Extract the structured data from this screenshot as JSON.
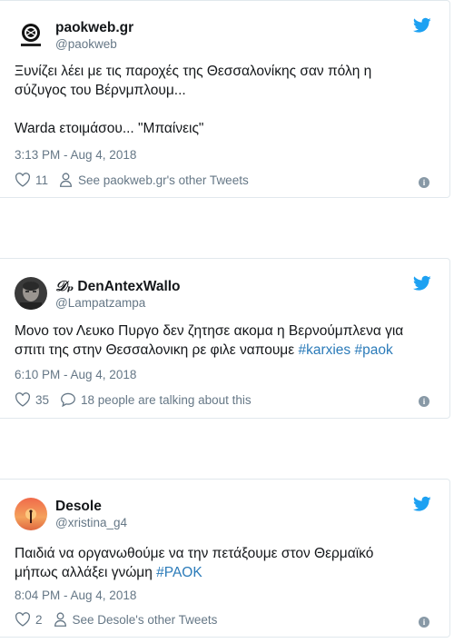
{
  "tweets": [
    {
      "name": "paokweb.gr",
      "handle": "@paokweb",
      "text_line1": "Ξυνίζει λέει με τις παροχές της Θεσσαλονίκης σαν πόλη η",
      "text_line2": "σύζυγος του Βέρνμπλουμ...",
      "text_line3": "Warda ετοιμάσου... \"Μπαίνεις\"",
      "time": "3:13 PM - Aug 4, 2018",
      "likes": "11",
      "secondary_action": "See paokweb.gr's other Tweets",
      "avatar_icon": "paok-logo-icon"
    },
    {
      "name": "DenAntexWallo",
      "name_prefix": "𝒟ₚ",
      "handle": "@Lampatzampa",
      "text_line1": "Μονο τον Λευκο Πυργο δεν ζητησε ακομα η Βερνούμπλενα για",
      "text_line2_plain": "σπιτι της στην Θεσσαλονικη ρε φιλε ναπουμε ",
      "hashtag1": "#karxies",
      "hashtag2": "#paok",
      "time": "6:10 PM - Aug 4, 2018",
      "likes": "35",
      "secondary_action": "18 people are talking about this",
      "avatar_icon": "profile-photo-icon"
    },
    {
      "name": "Desole",
      "handle": "@xristina_g4",
      "text_line1": "Παιδιά να οργανωθούμε να την πετάξουμε στον Θερμαϊκό",
      "text_line2_plain": "μήπως αλλάξει γνώμη ",
      "hashtag1": "#PAOK",
      "time": "8:04 PM - Aug 4, 2018",
      "likes": "2",
      "secondary_action": "See Desole's other Tweets",
      "avatar_icon": "sunset-photo-icon"
    }
  ],
  "colors": {
    "text": "#14171a",
    "muted": "#657786",
    "link": "#2b7bb9",
    "twitter_blue": "#1da1f2",
    "border": "#e1e8ed"
  },
  "info_glyph": "i"
}
